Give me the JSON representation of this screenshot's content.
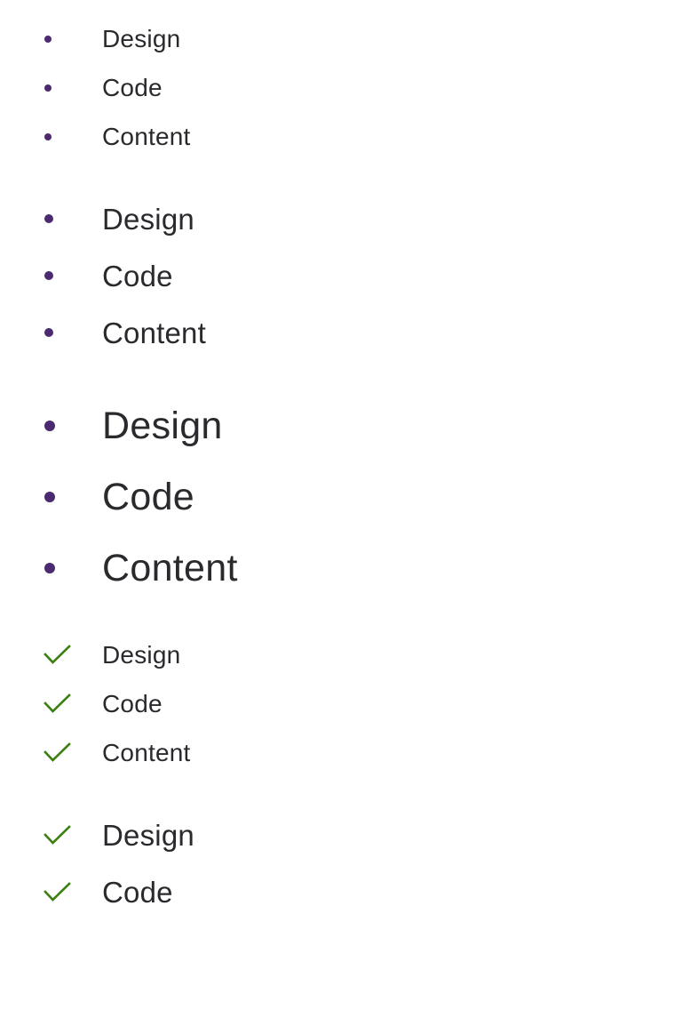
{
  "colors": {
    "bullet": "#4b2a6f",
    "check": "#3a7f10",
    "text": "#2a2a2e",
    "background": "#ffffff"
  },
  "lists": {
    "bullet_small": {
      "marker": "bullet-icon",
      "items": [
        {
          "label": "Design"
        },
        {
          "label": "Code"
        },
        {
          "label": "Content"
        }
      ]
    },
    "bullet_medium": {
      "marker": "bullet-icon",
      "items": [
        {
          "label": "Design"
        },
        {
          "label": "Code"
        },
        {
          "label": "Content"
        }
      ]
    },
    "bullet_large": {
      "marker": "bullet-icon",
      "items": [
        {
          "label": "Design"
        },
        {
          "label": "Code"
        },
        {
          "label": "Content"
        }
      ]
    },
    "check_small": {
      "marker": "checkmark-icon",
      "items": [
        {
          "label": "Design"
        },
        {
          "label": "Code"
        },
        {
          "label": "Content"
        }
      ]
    },
    "check_medium": {
      "marker": "checkmark-icon",
      "items": [
        {
          "label": "Design"
        },
        {
          "label": "Code"
        }
      ]
    }
  }
}
